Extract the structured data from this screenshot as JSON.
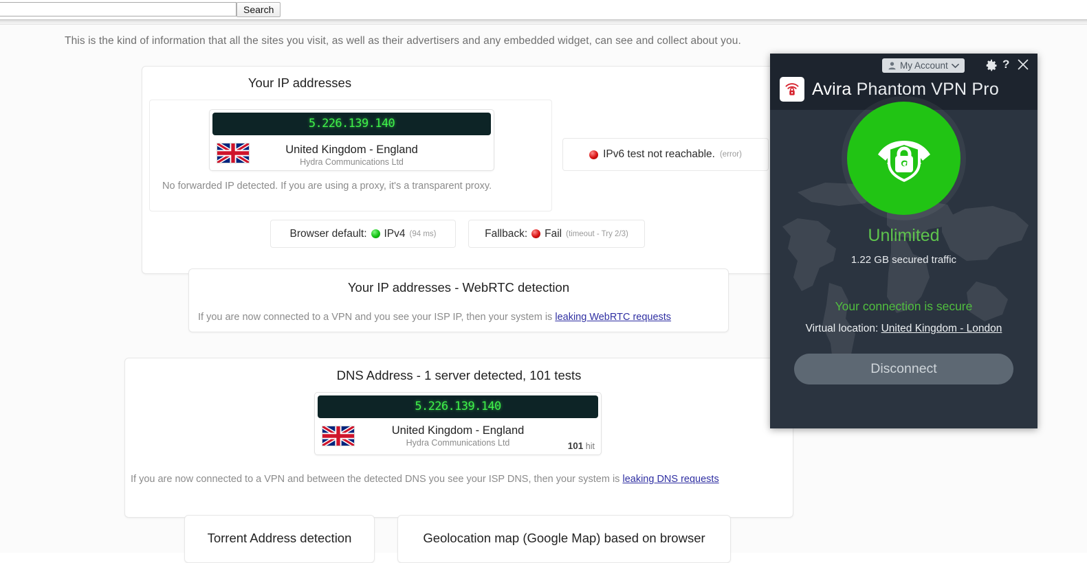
{
  "search": {
    "value": "",
    "placeholder": "",
    "button_label": "Search"
  },
  "intro": "This is the kind of information that all the sites you visit, as well as their advertisers and any embedded widget, can see and collect about you.",
  "ip_panel": {
    "title": "Your IP addresses",
    "ip": "5.226.139.140",
    "country": "United Kingdom - England",
    "isp": "Hydra Communications Ltd",
    "forwarded_note": "No forwarded IP detected. If you are using a proxy, it's a transparent proxy.",
    "ipv6": {
      "text": "IPv6 test not reachable.",
      "sub": "(error)",
      "status_color": "#d81212"
    },
    "browser_default": {
      "label": "Browser default:",
      "value": "IPv4",
      "sub": "(94 ms)",
      "status_color": "#14c114"
    },
    "fallback": {
      "label": "Fallback:",
      "value": "Fail",
      "sub": "(timeout - Try 2/3)",
      "status_color": "#d81212"
    }
  },
  "webrtc_panel": {
    "title": "Your IP addresses - WebRTC detection",
    "note_prefix": "If you are now connected to a VPN and you see your ISP IP, then your system is ",
    "note_link": "leaking WebRTC requests"
  },
  "dns_panel": {
    "title": "DNS Address - 1 server detected, 101 tests",
    "ip": "5.226.139.140",
    "country": "United Kingdom - England",
    "isp": "Hydra Communications Ltd",
    "hit_count": "101",
    "hit_label": "hit",
    "note_prefix": "If you are now connected to a VPN and between the detected DNS you see your ISP DNS, then your system is ",
    "note_link": "leaking DNS requests"
  },
  "bottom_panels": {
    "torrent": "Torrent Address detection",
    "geolocation": "Geolocation map (Google Map) based on browser"
  },
  "vpn": {
    "account_label": "My Account",
    "help_label": "?",
    "brand_bold": "Avira",
    "brand_rest": "Phantom VPN Pro",
    "plan": "Unlimited",
    "traffic": "1.22 GB secured traffic",
    "status": "Your connection is secure",
    "location_label": "Virtual location:",
    "location_value": "United Kingdom - London",
    "disconnect_label": "Disconnect",
    "accent_green": "#21c414",
    "status_green": "#51bf3f",
    "panel_bg": "#2b3440",
    "header_bg": "#1d242e"
  }
}
